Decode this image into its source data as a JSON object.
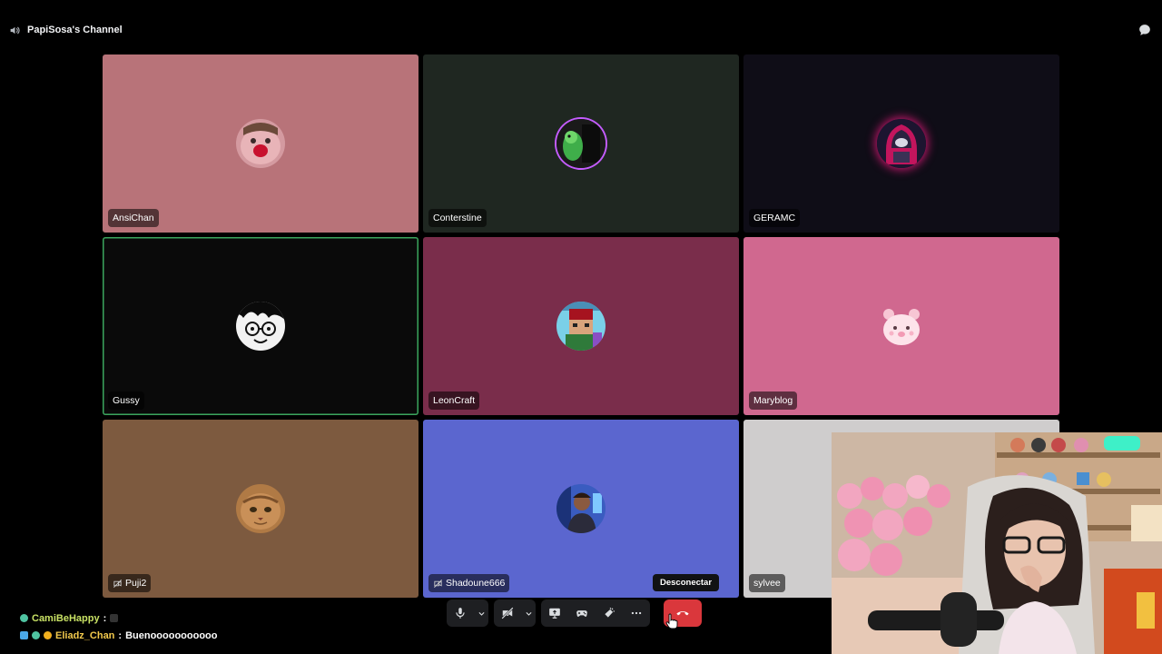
{
  "channel": {
    "name": "PapiSosa's Channel",
    "icon": "speaker-icon"
  },
  "participants": [
    {
      "name": "AnsiChan",
      "bg": "#b87379",
      "avatar": "pink-creature-avatar",
      "speaking": false,
      "muted_video": false
    },
    {
      "name": "Conterstine",
      "bg": "#1f2721",
      "avatar": "green-character-avatar",
      "speaking": false,
      "muted_video": false
    },
    {
      "name": "GERAMC",
      "bg": "#0f0d17",
      "avatar": "hooded-figure-avatar",
      "speaking": false,
      "muted_video": false
    },
    {
      "name": "Gussy",
      "bg": "#0a0a0a",
      "avatar": "cartoon-face-avatar",
      "speaking": true,
      "muted_video": false
    },
    {
      "name": "LeonCraft",
      "bg": "#7a2d4b",
      "avatar": "minecraft-skin-avatar",
      "speaking": false,
      "muted_video": false
    },
    {
      "name": "Maryblog",
      "bg": "#d0688f",
      "avatar": "pink-bear-avatar",
      "speaking": false,
      "muted_video": false
    },
    {
      "name": "Puji2",
      "bg": "#7d5a3f",
      "avatar": "cat-avatar",
      "speaking": false,
      "muted_video": true
    },
    {
      "name": "Shadoune666",
      "bg": "#5b66cf",
      "avatar": "person-avatar",
      "speaking": false,
      "muted_video": true
    },
    {
      "name": "sylvee",
      "bg": "#cfcdcd",
      "avatar": "",
      "speaking": false,
      "muted_video": false
    }
  ],
  "chat": [
    {
      "user": "CamiBeHappy",
      "separator": " :",
      "text": ""
    },
    {
      "user": "Eliadz_Chan",
      "separator": " :",
      "text": " Buenooooooooooo"
    }
  ],
  "controls": {
    "tooltip": "Desconectar",
    "buttons": [
      "microphone-icon",
      "chevron-down-icon",
      "camera-off-icon",
      "chevron-down-icon",
      "screen-share-icon",
      "gamepad-icon",
      "soundboard-icon",
      "more-icon",
      "hang-up-icon"
    ],
    "disconnect_color": "#da373c"
  },
  "colors": {
    "speaking_ring": "#3ba55d",
    "background": "#000000"
  }
}
